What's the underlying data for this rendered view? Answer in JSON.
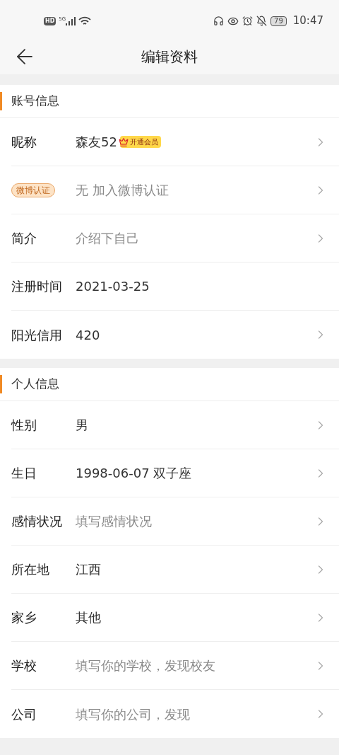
{
  "status_bar": {
    "hd": "HD",
    "network": "5G",
    "battery": "79",
    "time": "10:47"
  },
  "header": {
    "title": "编辑资料"
  },
  "sections": [
    {
      "title": "账号信息",
      "rows": [
        {
          "kind": "text",
          "label": "昵称",
          "value": "森友52",
          "muted": false,
          "badge": "开通会员",
          "arrow": true
        },
        {
          "kind": "tag",
          "label": "微博认证",
          "value": "无 加入微博认证",
          "muted": true,
          "arrow": true
        },
        {
          "kind": "text",
          "label": "简介",
          "value": "介绍下自己",
          "muted": true,
          "arrow": true
        },
        {
          "kind": "text",
          "label": "注册时间",
          "value": "2021-03-25",
          "muted": false,
          "arrow": false
        },
        {
          "kind": "text",
          "label": "阳光信用",
          "value": "420",
          "muted": false,
          "arrow": true
        }
      ]
    },
    {
      "title": "个人信息",
      "rows": [
        {
          "kind": "text",
          "label": "性别",
          "value": "男",
          "muted": false,
          "arrow": true
        },
        {
          "kind": "text",
          "label": "生日",
          "value": "1998-06-07 双子座",
          "muted": false,
          "arrow": true
        },
        {
          "kind": "text",
          "label": "感情状况",
          "value": "填写感情状况",
          "muted": true,
          "arrow": true
        },
        {
          "kind": "text",
          "label": "所在地",
          "value": "江西",
          "muted": false,
          "arrow": true
        },
        {
          "kind": "text",
          "label": "家乡",
          "value": "其他",
          "muted": false,
          "arrow": true
        },
        {
          "kind": "text",
          "label": "学校",
          "value": "填写你的学校，发现校友",
          "muted": true,
          "arrow": true
        },
        {
          "kind": "text",
          "label": "公司",
          "value": "填写你的公司，发现",
          "muted": true,
          "arrow": true
        }
      ]
    }
  ]
}
